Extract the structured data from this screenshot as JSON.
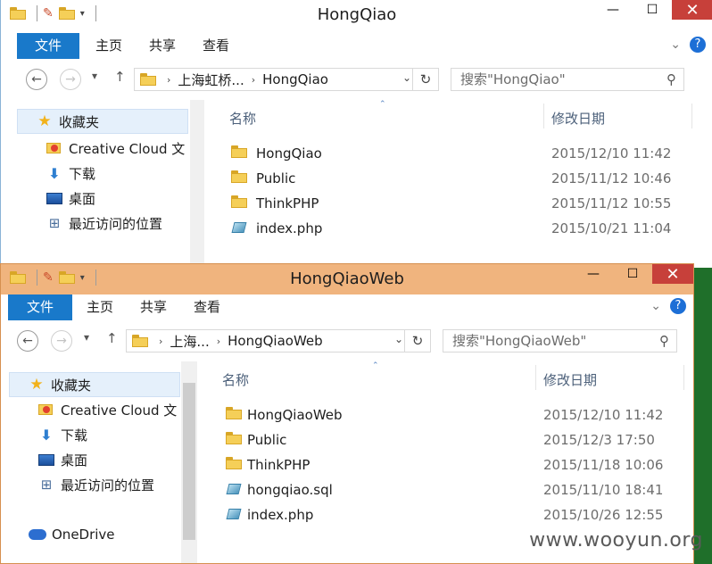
{
  "window1": {
    "title": "HongQiao",
    "tabs": [
      "文件",
      "主页",
      "共享",
      "查看"
    ],
    "nav": {
      "back": "←",
      "forward": "→",
      "recent": "▾",
      "up": "↑"
    },
    "path": [
      "上海虹桥...",
      "HongQiao"
    ],
    "search_placeholder": "搜索\"HongQiao\"",
    "sidebar": [
      {
        "label": "收藏夹",
        "icon": "star-icon"
      },
      {
        "label": "Creative Cloud 文",
        "icon": "creative-cloud-folder-icon"
      },
      {
        "label": "下载",
        "icon": "download-icon"
      },
      {
        "label": "桌面",
        "icon": "desktop-icon"
      },
      {
        "label": "最近访问的位置",
        "icon": "recent-places-icon"
      }
    ],
    "columns": {
      "name": "名称",
      "modified": "修改日期"
    },
    "files": [
      {
        "name": "HongQiao",
        "date": "2015/12/10 11:42",
        "type": "folder"
      },
      {
        "name": "Public",
        "date": "2015/11/12 10:46",
        "type": "folder"
      },
      {
        "name": "ThinkPHP",
        "date": "2015/11/12 10:55",
        "type": "folder"
      },
      {
        "name": "index.php",
        "date": "2015/10/21 11:04",
        "type": "php"
      }
    ]
  },
  "window2": {
    "title": "HongQiaoWeb",
    "tabs": [
      "文件",
      "主页",
      "共享",
      "查看"
    ],
    "path": [
      "上海...",
      "HongQiaoWeb"
    ],
    "search_placeholder": "搜索\"HongQiaoWeb\"",
    "sidebar": [
      {
        "label": "收藏夹",
        "icon": "star-icon"
      },
      {
        "label": "Creative Cloud 文",
        "icon": "creative-cloud-folder-icon"
      },
      {
        "label": "下载",
        "icon": "download-icon"
      },
      {
        "label": "桌面",
        "icon": "desktop-icon"
      },
      {
        "label": "最近访问的位置",
        "icon": "recent-places-icon"
      },
      {
        "label": "OneDrive",
        "icon": "onedrive-icon"
      }
    ],
    "columns": {
      "name": "名称",
      "modified": "修改日期"
    },
    "files": [
      {
        "name": "HongQiaoWeb",
        "date": "2015/12/10 11:42",
        "type": "folder"
      },
      {
        "name": "Public",
        "date": "2015/12/3 17:50",
        "type": "folder"
      },
      {
        "name": "ThinkPHP",
        "date": "2015/11/18 10:06",
        "type": "folder"
      },
      {
        "name": "hongqiao.sql",
        "date": "2015/11/10 18:41",
        "type": "file"
      },
      {
        "name": "index.php",
        "date": "2015/10/26 12:55",
        "type": "php"
      }
    ]
  },
  "watermark": "www.wooyun.org",
  "colors": {
    "accent": "#1979ca",
    "inactive_frame": "#f0b47e",
    "close": "#c7403a"
  }
}
